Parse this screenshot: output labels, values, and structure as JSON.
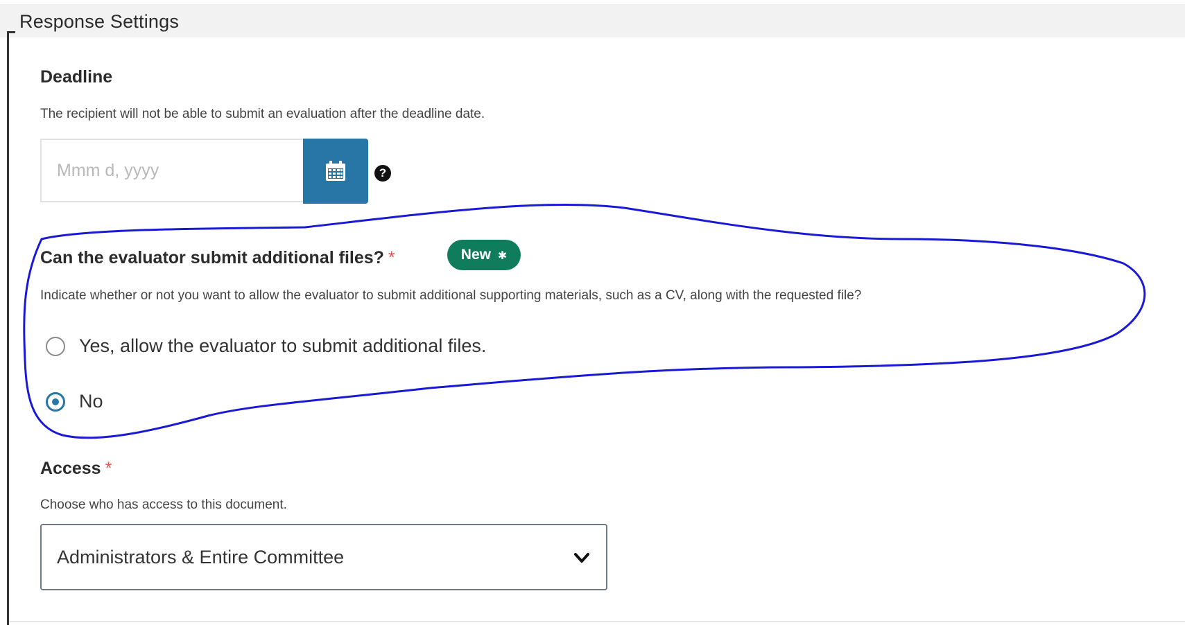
{
  "header": {
    "title": "Response Settings"
  },
  "deadline": {
    "label": "Deadline",
    "help": "The recipient will not be able to submit an evaluation after the deadline date.",
    "placeholder": "Mmm d, yyyy",
    "calendar_icon": "calendar-icon",
    "help_icon": "question-circle-icon",
    "help_glyph": "?"
  },
  "additional_files": {
    "label": "Can the evaluator submit additional files?",
    "required_mark": "*",
    "badge": "New",
    "badge_glyph": "✱",
    "help": "Indicate whether or not you want to allow the evaluator to submit additional supporting materials, such as a CV, along with the requested file?",
    "options": [
      {
        "label": "Yes, allow the evaluator to submit additional files.",
        "selected": false
      },
      {
        "label": "No",
        "selected": true
      }
    ]
  },
  "access": {
    "label": "Access",
    "required_mark": "*",
    "help": "Choose who has access to this document.",
    "selected_value": "Administrators & Entire Committee",
    "chevron_icon": "chevron-down-icon"
  },
  "colors": {
    "primary": "#2776a5",
    "badge": "#0f7d5c",
    "required": "#d9534f",
    "annotation": "#1a1ad6"
  }
}
